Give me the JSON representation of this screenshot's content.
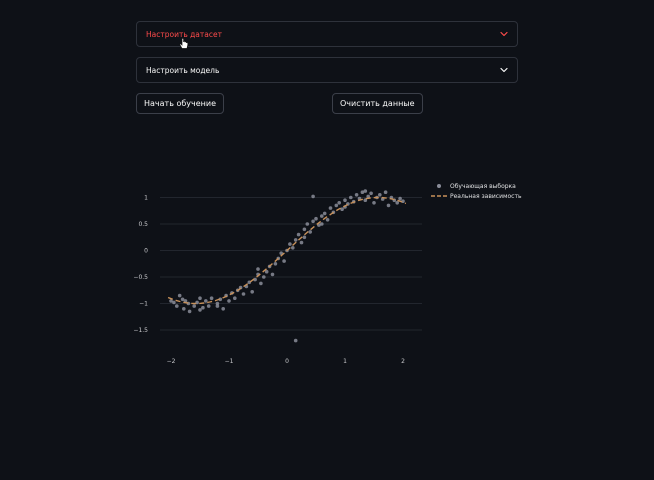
{
  "expanders": {
    "dataset": {
      "label": "Настроить датасет",
      "state": "hovered"
    },
    "model": {
      "label": "Настроить модель"
    }
  },
  "buttons": {
    "train": "Начать обучение",
    "clear": "Очистить данные"
  },
  "icons": {
    "expander_chevron": "chevron-down-icon",
    "cursor": "hand-pointer-icon"
  },
  "colors": {
    "background": "#0e1117",
    "accent": "#ff4b4b",
    "points": "#8a8d99",
    "true_line": "#c8915a"
  },
  "chart_data": {
    "type": "scatter",
    "x_ticks": [
      "−2",
      "−1",
      "0",
      "1",
      "2"
    ],
    "y_ticks": [
      "1",
      "0.5",
      "0",
      "−0.5",
      "−1",
      "−1.5"
    ],
    "xlim": [
      -2.3,
      2.3
    ],
    "ylim": [
      -1.85,
      1.3
    ],
    "grid": true,
    "legend_position": "top-right",
    "series": [
      {
        "name": "Обучающая выборка",
        "kind": "points",
        "color": "#8a8d99",
        "points": [
          [
            -2.0,
            -0.95
          ],
          [
            -1.95,
            -0.98
          ],
          [
            -1.9,
            -1.05
          ],
          [
            -1.85,
            -0.85
          ],
          [
            -1.8,
            -0.92
          ],
          [
            -1.78,
            -1.1
          ],
          [
            -1.75,
            -0.95
          ],
          [
            -1.7,
            -1.0
          ],
          [
            -1.68,
            -1.15
          ],
          [
            -1.6,
            -1.05
          ],
          [
            -1.55,
            -0.98
          ],
          [
            -1.5,
            -1.12
          ],
          [
            -1.45,
            -1.08
          ],
          [
            -1.4,
            -0.95
          ],
          [
            -1.35,
            -1.05
          ],
          [
            -1.3,
            -0.9
          ],
          [
            -1.2,
            -1.0
          ],
          [
            -1.15,
            -0.92
          ],
          [
            -1.1,
            -1.1
          ],
          [
            -1.05,
            -0.85
          ],
          [
            -1.0,
            -0.95
          ],
          [
            -0.95,
            -0.8
          ],
          [
            -0.9,
            -0.9
          ],
          [
            -0.85,
            -0.75
          ],
          [
            -0.8,
            -0.7
          ],
          [
            -0.75,
            -0.82
          ],
          [
            -0.7,
            -0.68
          ],
          [
            -0.65,
            -0.6
          ],
          [
            -0.6,
            -0.78
          ],
          [
            -0.55,
            -0.55
          ],
          [
            -0.5,
            -0.45
          ],
          [
            -0.45,
            -0.62
          ],
          [
            -0.4,
            -0.5
          ],
          [
            -0.35,
            -0.4
          ],
          [
            -0.3,
            -0.3
          ],
          [
            -0.25,
            -0.45
          ],
          [
            -0.2,
            -0.25
          ],
          [
            -0.15,
            -0.15
          ],
          [
            -0.1,
            -0.05
          ],
          [
            -0.05,
            -0.2
          ],
          [
            0.0,
            0.0
          ],
          [
            0.05,
            0.12
          ],
          [
            0.1,
            0.05
          ],
          [
            0.15,
            0.2
          ],
          [
            0.2,
            0.3
          ],
          [
            0.25,
            0.15
          ],
          [
            0.3,
            0.4
          ],
          [
            0.35,
            0.5
          ],
          [
            0.4,
            0.35
          ],
          [
            0.45,
            0.55
          ],
          [
            0.5,
            0.6
          ],
          [
            0.55,
            0.48
          ],
          [
            0.6,
            0.65
          ],
          [
            0.65,
            0.7
          ],
          [
            0.7,
            0.58
          ],
          [
            0.75,
            0.8
          ],
          [
            0.8,
            0.72
          ],
          [
            0.85,
            0.85
          ],
          [
            0.9,
            0.9
          ],
          [
            0.95,
            0.78
          ],
          [
            1.0,
            0.95
          ],
          [
            1.05,
            0.88
          ],
          [
            1.1,
            1.0
          ],
          [
            1.15,
            0.92
          ],
          [
            1.2,
            1.05
          ],
          [
            1.25,
            0.98
          ],
          [
            1.3,
            1.1
          ],
          [
            1.35,
            0.95
          ],
          [
            1.4,
            1.02
          ],
          [
            1.45,
            1.08
          ],
          [
            1.5,
            0.9
          ],
          [
            1.55,
            1.0
          ],
          [
            1.6,
            1.05
          ],
          [
            1.65,
            0.97
          ],
          [
            1.7,
            1.1
          ],
          [
            1.75,
            0.85
          ],
          [
            1.8,
            1.0
          ],
          [
            1.85,
            0.95
          ],
          [
            1.9,
            0.9
          ],
          [
            1.95,
            0.98
          ],
          [
            2.0,
            0.93
          ],
          [
            0.45,
            1.02
          ],
          [
            0.15,
            -1.7
          ],
          [
            -1.2,
            -1.05
          ],
          [
            -0.5,
            -0.35
          ],
          [
            0.3,
            0.25
          ],
          [
            1.0,
            0.82
          ],
          [
            -1.5,
            -0.9
          ],
          [
            0.6,
            0.5
          ],
          [
            1.35,
            1.12
          ]
        ]
      },
      {
        "name": "Реальная зависимость",
        "kind": "dashed-line",
        "color": "#c8915a",
        "function": "sin(x)"
      }
    ]
  }
}
